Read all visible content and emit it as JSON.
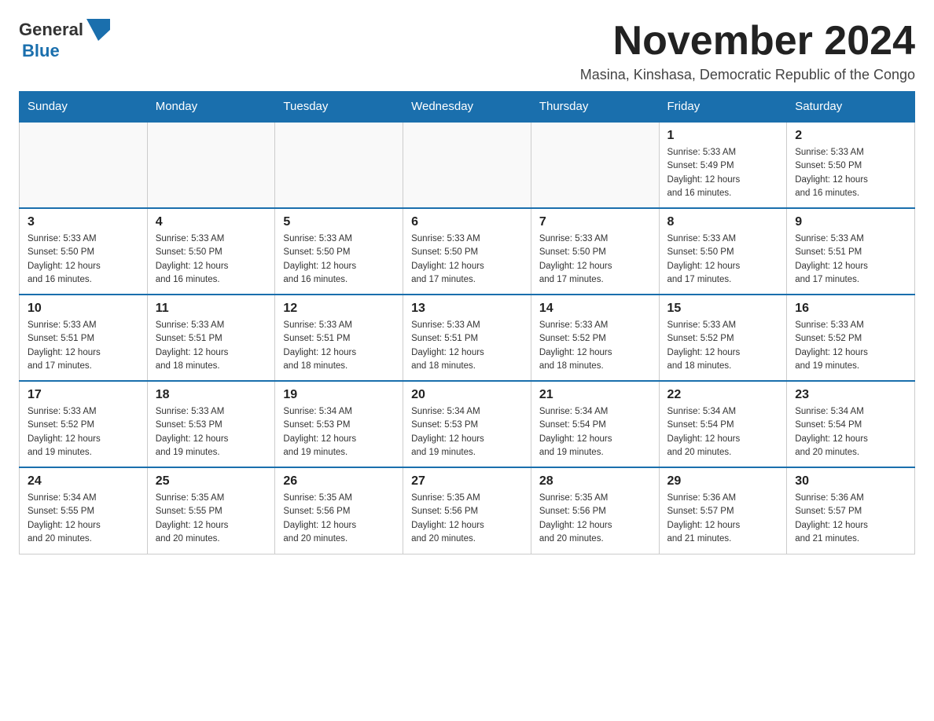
{
  "logo": {
    "general": "General",
    "blue": "Blue"
  },
  "title": "November 2024",
  "location": "Masina, Kinshasa, Democratic Republic of the Congo",
  "days_of_week": [
    "Sunday",
    "Monday",
    "Tuesday",
    "Wednesday",
    "Thursday",
    "Friday",
    "Saturday"
  ],
  "weeks": [
    [
      {
        "day": "",
        "info": ""
      },
      {
        "day": "",
        "info": ""
      },
      {
        "day": "",
        "info": ""
      },
      {
        "day": "",
        "info": ""
      },
      {
        "day": "",
        "info": ""
      },
      {
        "day": "1",
        "info": "Sunrise: 5:33 AM\nSunset: 5:49 PM\nDaylight: 12 hours\nand 16 minutes."
      },
      {
        "day": "2",
        "info": "Sunrise: 5:33 AM\nSunset: 5:50 PM\nDaylight: 12 hours\nand 16 minutes."
      }
    ],
    [
      {
        "day": "3",
        "info": "Sunrise: 5:33 AM\nSunset: 5:50 PM\nDaylight: 12 hours\nand 16 minutes."
      },
      {
        "day": "4",
        "info": "Sunrise: 5:33 AM\nSunset: 5:50 PM\nDaylight: 12 hours\nand 16 minutes."
      },
      {
        "day": "5",
        "info": "Sunrise: 5:33 AM\nSunset: 5:50 PM\nDaylight: 12 hours\nand 16 minutes."
      },
      {
        "day": "6",
        "info": "Sunrise: 5:33 AM\nSunset: 5:50 PM\nDaylight: 12 hours\nand 17 minutes."
      },
      {
        "day": "7",
        "info": "Sunrise: 5:33 AM\nSunset: 5:50 PM\nDaylight: 12 hours\nand 17 minutes."
      },
      {
        "day": "8",
        "info": "Sunrise: 5:33 AM\nSunset: 5:50 PM\nDaylight: 12 hours\nand 17 minutes."
      },
      {
        "day": "9",
        "info": "Sunrise: 5:33 AM\nSunset: 5:51 PM\nDaylight: 12 hours\nand 17 minutes."
      }
    ],
    [
      {
        "day": "10",
        "info": "Sunrise: 5:33 AM\nSunset: 5:51 PM\nDaylight: 12 hours\nand 17 minutes."
      },
      {
        "day": "11",
        "info": "Sunrise: 5:33 AM\nSunset: 5:51 PM\nDaylight: 12 hours\nand 18 minutes."
      },
      {
        "day": "12",
        "info": "Sunrise: 5:33 AM\nSunset: 5:51 PM\nDaylight: 12 hours\nand 18 minutes."
      },
      {
        "day": "13",
        "info": "Sunrise: 5:33 AM\nSunset: 5:51 PM\nDaylight: 12 hours\nand 18 minutes."
      },
      {
        "day": "14",
        "info": "Sunrise: 5:33 AM\nSunset: 5:52 PM\nDaylight: 12 hours\nand 18 minutes."
      },
      {
        "day": "15",
        "info": "Sunrise: 5:33 AM\nSunset: 5:52 PM\nDaylight: 12 hours\nand 18 minutes."
      },
      {
        "day": "16",
        "info": "Sunrise: 5:33 AM\nSunset: 5:52 PM\nDaylight: 12 hours\nand 19 minutes."
      }
    ],
    [
      {
        "day": "17",
        "info": "Sunrise: 5:33 AM\nSunset: 5:52 PM\nDaylight: 12 hours\nand 19 minutes."
      },
      {
        "day": "18",
        "info": "Sunrise: 5:33 AM\nSunset: 5:53 PM\nDaylight: 12 hours\nand 19 minutes."
      },
      {
        "day": "19",
        "info": "Sunrise: 5:34 AM\nSunset: 5:53 PM\nDaylight: 12 hours\nand 19 minutes."
      },
      {
        "day": "20",
        "info": "Sunrise: 5:34 AM\nSunset: 5:53 PM\nDaylight: 12 hours\nand 19 minutes."
      },
      {
        "day": "21",
        "info": "Sunrise: 5:34 AM\nSunset: 5:54 PM\nDaylight: 12 hours\nand 19 minutes."
      },
      {
        "day": "22",
        "info": "Sunrise: 5:34 AM\nSunset: 5:54 PM\nDaylight: 12 hours\nand 20 minutes."
      },
      {
        "day": "23",
        "info": "Sunrise: 5:34 AM\nSunset: 5:54 PM\nDaylight: 12 hours\nand 20 minutes."
      }
    ],
    [
      {
        "day": "24",
        "info": "Sunrise: 5:34 AM\nSunset: 5:55 PM\nDaylight: 12 hours\nand 20 minutes."
      },
      {
        "day": "25",
        "info": "Sunrise: 5:35 AM\nSunset: 5:55 PM\nDaylight: 12 hours\nand 20 minutes."
      },
      {
        "day": "26",
        "info": "Sunrise: 5:35 AM\nSunset: 5:56 PM\nDaylight: 12 hours\nand 20 minutes."
      },
      {
        "day": "27",
        "info": "Sunrise: 5:35 AM\nSunset: 5:56 PM\nDaylight: 12 hours\nand 20 minutes."
      },
      {
        "day": "28",
        "info": "Sunrise: 5:35 AM\nSunset: 5:56 PM\nDaylight: 12 hours\nand 20 minutes."
      },
      {
        "day": "29",
        "info": "Sunrise: 5:36 AM\nSunset: 5:57 PM\nDaylight: 12 hours\nand 21 minutes."
      },
      {
        "day": "30",
        "info": "Sunrise: 5:36 AM\nSunset: 5:57 PM\nDaylight: 12 hours\nand 21 minutes."
      }
    ]
  ]
}
